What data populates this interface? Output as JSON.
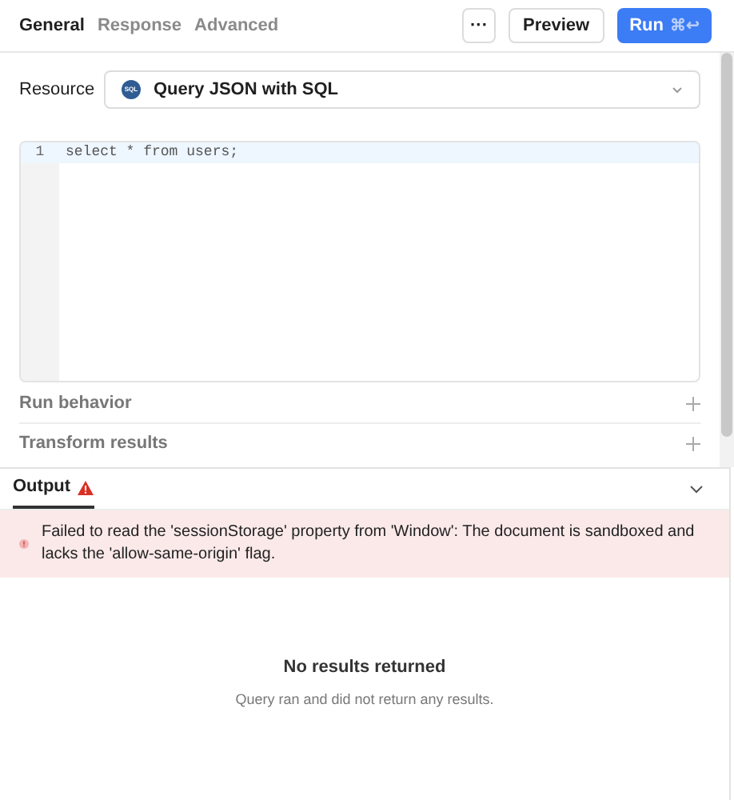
{
  "tabs": [
    {
      "label": "General",
      "selected": true
    },
    {
      "label": "Response",
      "selected": false
    },
    {
      "label": "Advanced",
      "selected": false
    }
  ],
  "toolbar": {
    "more": "···",
    "preview": "Preview",
    "run": "Run",
    "run_shortcut": "⌘↩"
  },
  "resource": {
    "label": "Resource",
    "icon_text": "SQL",
    "value": "Query JSON with SQL"
  },
  "editor": {
    "lines": [
      {
        "number": "1",
        "code": "select * from users;",
        "active": true
      }
    ]
  },
  "sections": [
    {
      "label": "Run behavior",
      "expanded": false
    },
    {
      "label": "Transform results",
      "expanded": false
    }
  ],
  "output": {
    "title": "Output",
    "has_error": true,
    "expanded": true,
    "error": "Failed to read the 'sessionStorage' property from 'Window': The document is sandboxed and lacks the 'allow-same-origin' flag.",
    "empty_title": "No results returned",
    "empty_subtitle": "Query ran and did not return any results."
  }
}
